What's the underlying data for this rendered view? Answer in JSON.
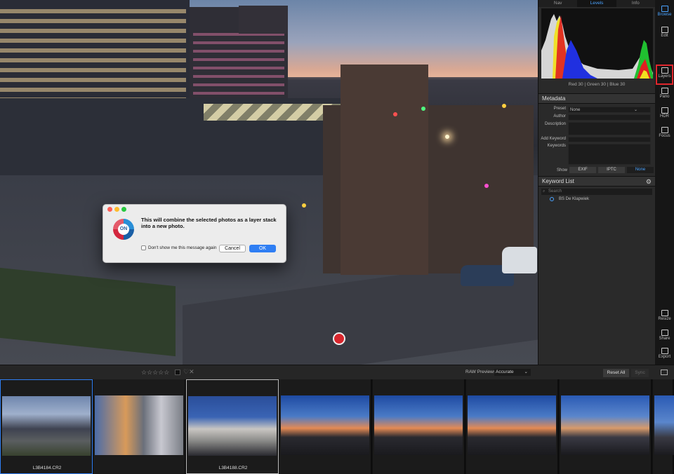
{
  "dialog": {
    "message": "This will combine the selected photos as a layer stack into a new photo.",
    "checkbox_label": "Don't show me this message again",
    "cancel_label": "Cancel",
    "ok_label": "OK",
    "logo_text": "ON"
  },
  "panel": {
    "tabs": [
      "Nav",
      "Levels",
      "Info"
    ],
    "active_tab": "Levels",
    "rgb_readout": "Red  30  | Green  30  | Blue  30",
    "metadata": {
      "title": "Metadata",
      "preset_label": "Preset",
      "preset_value": "None",
      "author_label": "Author",
      "description_label": "Description",
      "add_keyword_label": "Add Keyword",
      "keywords_label": "Keywords",
      "show_label": "Show",
      "show_options": [
        "EXIF",
        "IPTC",
        "None"
      ],
      "show_active": "None"
    },
    "keyword_list": {
      "title": "Keyword List",
      "search_placeholder": "Search",
      "items": [
        "BS De Klapwiek"
      ]
    }
  },
  "toolbar": {
    "items": [
      {
        "label": "Browse",
        "icon": "browse-icon"
      },
      {
        "label": "Edit",
        "icon": "edit-sliders-icon"
      },
      {
        "label": "Layers",
        "icon": "layers-icon"
      },
      {
        "label": "Pano",
        "icon": "pano-icon"
      },
      {
        "label": "HDR",
        "icon": "hdr-icon"
      },
      {
        "label": "Focus",
        "icon": "focus-icon"
      },
      {
        "label": "Resize",
        "icon": "resize-icon"
      },
      {
        "label": "Share",
        "icon": "share-icon"
      },
      {
        "label": "Export",
        "icon": "export-icon"
      }
    ],
    "active": "Browse",
    "highlighted": "Layers"
  },
  "filmbar": {
    "stars": "☆☆☆☆☆",
    "heart": "♡✕",
    "raw_previews_label": "RAW Previews",
    "raw_previews_value": "Accurate",
    "reset_all_label": "Reset All",
    "sync_label": "Sync"
  },
  "filmstrip": {
    "thumbs": [
      {
        "name": "L3B4184.CR2",
        "selected": "primary"
      },
      {
        "name": "",
        "selected": "none"
      },
      {
        "name": "L3B4188.CR2",
        "selected": "secondary"
      },
      {
        "name": "",
        "selected": "none"
      },
      {
        "name": "",
        "selected": "none"
      },
      {
        "name": "",
        "selected": "none"
      },
      {
        "name": "",
        "selected": "none"
      },
      {
        "name": "",
        "selected": "none"
      }
    ]
  },
  "colors": {
    "accent": "#2f7ef3",
    "highlight_box": "#e0262d",
    "panel_bg": "#2a2a2a"
  }
}
